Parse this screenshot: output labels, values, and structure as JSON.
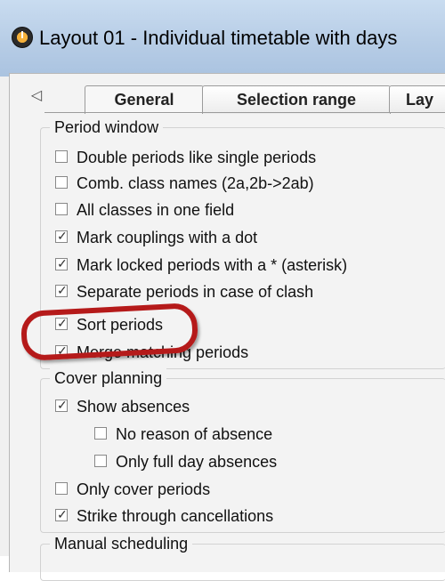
{
  "window": {
    "title": "Layout 01 - Individual timetable with days"
  },
  "tabs": {
    "scroll_left": "◁",
    "items": [
      {
        "label": "General"
      },
      {
        "label": "Selection range"
      },
      {
        "label": "Lay"
      }
    ]
  },
  "groups": {
    "period_window": {
      "legend": "Period window",
      "options": [
        {
          "label": "Double periods like single periods",
          "checked": false
        },
        {
          "label": "Comb. class names (2a,2b->2ab)",
          "checked": false
        },
        {
          "label": "All classes in one field",
          "checked": false
        },
        {
          "label": "Mark couplings with a dot",
          "checked": true
        },
        {
          "label": "Mark locked periods with a * (asterisk)",
          "checked": true
        },
        {
          "label": "Separate periods in case of clash",
          "checked": true
        },
        {
          "label": "Sort periods",
          "checked": true
        },
        {
          "label": "Merge matching periods",
          "checked": true
        }
      ]
    },
    "cover_planning": {
      "legend": "Cover planning",
      "options": [
        {
          "label": "Show absences",
          "checked": true
        },
        {
          "label": "No reason of absence",
          "checked": false
        },
        {
          "label": "Only full day absences",
          "checked": false
        },
        {
          "label": "Only cover periods",
          "checked": false
        },
        {
          "label": "Strike through cancellations",
          "checked": true
        }
      ]
    },
    "manual_scheduling": {
      "legend": "Manual scheduling"
    }
  },
  "check_glyph": "✓",
  "colors": {
    "title_bar": "#b7cde6",
    "panel": "#f3f3f3",
    "highlight_ring": "#b51a1a"
  }
}
